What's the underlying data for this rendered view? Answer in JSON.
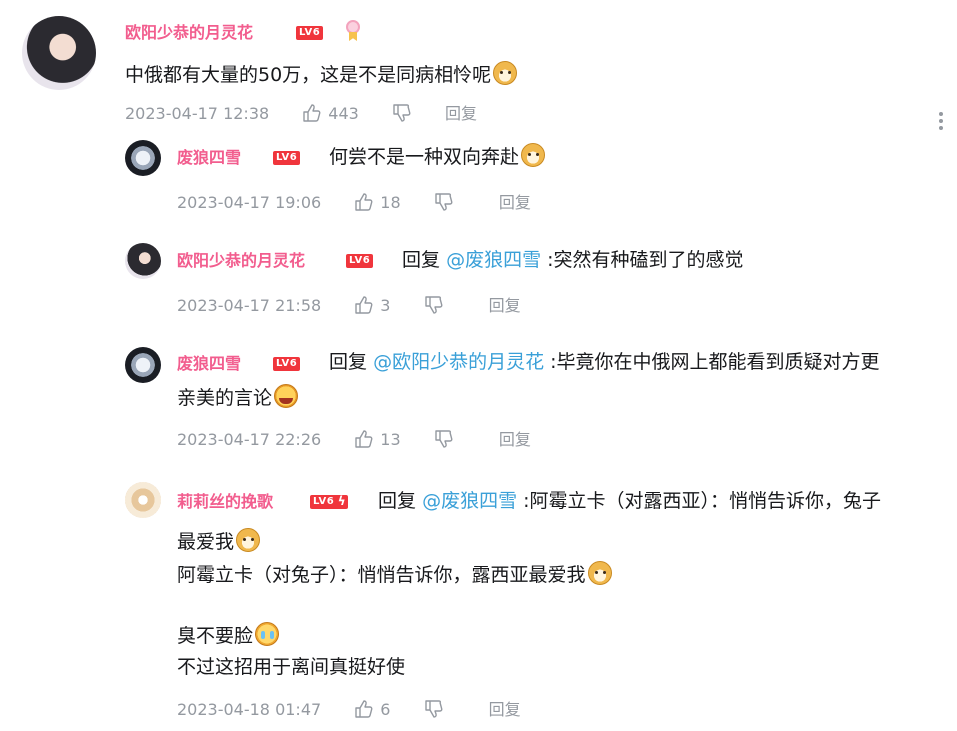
{
  "comment": {
    "user": "欧阳少恭的月灵花",
    "level": "LV6",
    "text": "中俄都有大量的50万，这是不是同病相怜呢",
    "time": "2023-04-17 12:38",
    "likes": "443",
    "reply_label": "回复"
  },
  "replies": [
    {
      "user": "废狼四雪",
      "level": "LV6",
      "text": "何尝不是一种双向奔赴",
      "time": "2023-04-17 19:06",
      "likes": "18",
      "reply_label": "回复"
    },
    {
      "user": "欧阳少恭的月灵花",
      "level": "LV6",
      "reply_word": "回复",
      "mention": "@废狼四雪",
      "text": ":突然有种磕到了的感觉",
      "time": "2023-04-17 21:58",
      "likes": "3",
      "reply_label": "回复"
    },
    {
      "user": "废狼四雪",
      "level": "LV6",
      "reply_word": "回复",
      "mention": "@欧阳少恭的月灵花",
      "text_line1": ":毕竟你在中俄网上都能看到质疑对方更",
      "text_line2": "亲美的言论",
      "time": "2023-04-17 22:26",
      "likes": "13",
      "reply_label": "回复"
    },
    {
      "user": "莉莉丝的挽歌",
      "level": "LV6",
      "reply_word": "回复",
      "mention": "@废狼四雪",
      "text_line1": ":阿霉立卡（对露西亚）：悄悄告诉你，兔子",
      "text_line2": "最爱我",
      "text_line3": "阿霉立卡（对兔子）：悄悄告诉你，露西亚最爱我",
      "text_line4": "臭不要脸",
      "text_line5": "不过这招用于离间真挺好使",
      "time": "2023-04-18 01:47",
      "likes": "6",
      "reply_label": "回复"
    }
  ],
  "icons": {
    "like": "thumbs-up-icon",
    "dislike": "thumbs-down-icon",
    "more": "more-vertical-icon",
    "emoji_doge": "doge-emoji",
    "emoji_cry": "cry-emoji",
    "emoji_laugh": "laugh-emoji"
  },
  "colors": {
    "username": "#f25d8e",
    "mention": "#3aa0d8",
    "meta": "#9499a0",
    "level_badge": "#f0353c"
  }
}
